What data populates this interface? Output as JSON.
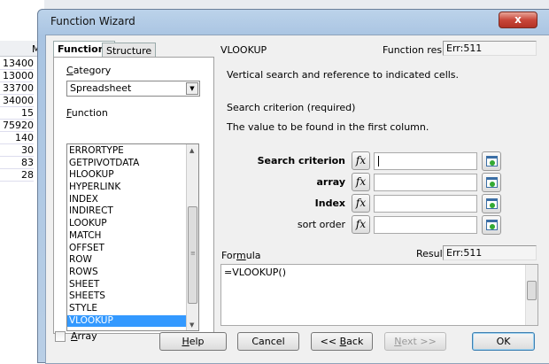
{
  "sheet": {
    "column_header": "M",
    "cells": [
      "13400",
      "13000",
      "33700",
      "34000",
      "15",
      "75920",
      "140",
      "30",
      "83",
      "28"
    ]
  },
  "dialog": {
    "title": "Function Wizard",
    "close": "x"
  },
  "tabs": [
    "Functions",
    "Structure"
  ],
  "category": {
    "label": "Category",
    "value": "Spreadsheet"
  },
  "function_label": "Function",
  "functions": [
    "ERRORTYPE",
    "GETPIVOTDATA",
    "HLOOKUP",
    "HYPERLINK",
    "INDEX",
    "INDIRECT",
    "LOOKUP",
    "MATCH",
    "OFFSET",
    "ROW",
    "ROWS",
    "SHEET",
    "SHEETS",
    "STYLE",
    "VLOOKUP"
  ],
  "selected_function": "VLOOKUP",
  "right": {
    "name": "VLOOKUP",
    "function_result_label": "Function result",
    "function_result": "Err:511",
    "description": "Vertical search and reference to indicated cells.",
    "param_title": "Search criterion (required)",
    "param_desc": "The value to be found in the first column."
  },
  "args": [
    {
      "label": "Search criterion",
      "value": ""
    },
    {
      "label": "array",
      "value": ""
    },
    {
      "label": "Index",
      "value": ""
    },
    {
      "label": "sort order",
      "value": ""
    }
  ],
  "formula": {
    "label": "Formula",
    "result_label": "Result",
    "result": "Err:511",
    "value": "=VLOOKUP()"
  },
  "array_checkbox": {
    "label": "Array",
    "checked": false
  },
  "buttons": {
    "help": "Help",
    "cancel": "Cancel",
    "back": "<< Back",
    "next": "Next >>",
    "ok": "OK"
  },
  "icons": {
    "fx": "fx"
  }
}
